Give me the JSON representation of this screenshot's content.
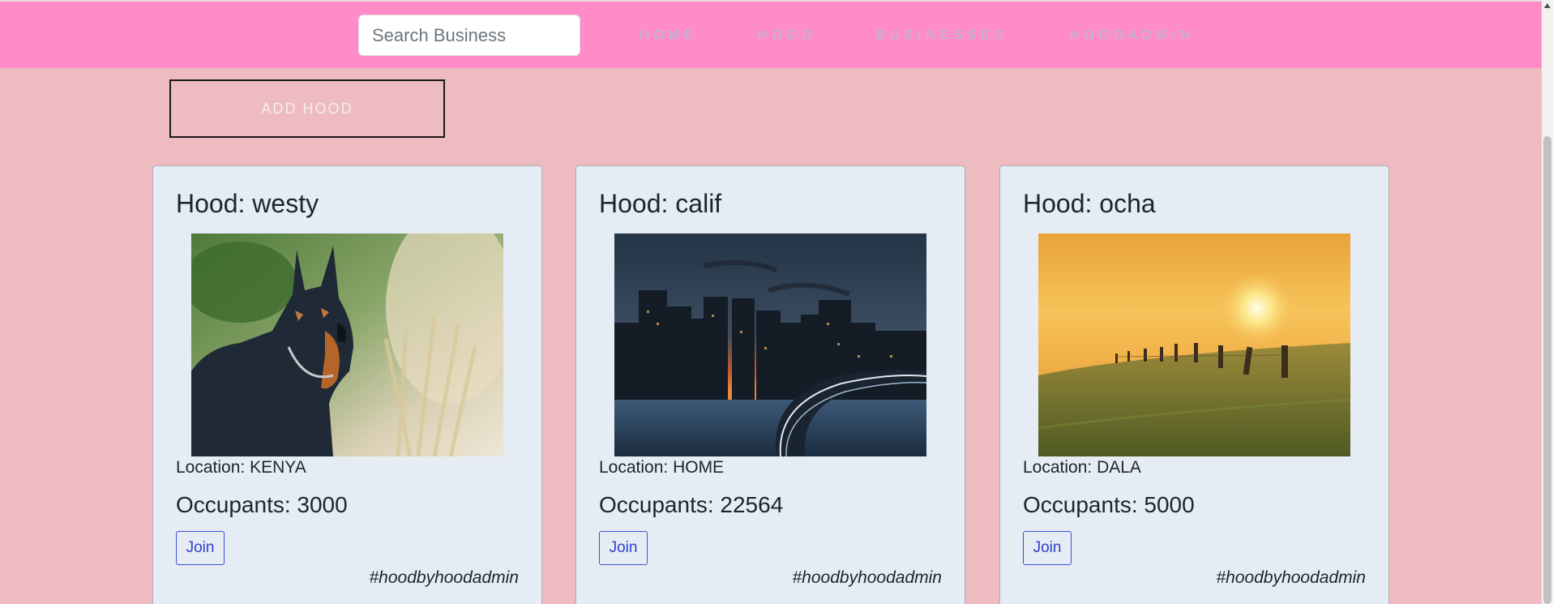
{
  "navbar": {
    "search_placeholder": "Search Business",
    "links": [
      "HOME",
      "HOOD",
      "BUSINESSES",
      "HOODADMIN"
    ]
  },
  "actions": {
    "add_hood_label": "ADD HOOD"
  },
  "hoods": [
    {
      "title": "Hood: westy",
      "location": "Location: KENYA",
      "occupants": "Occupants: 3000",
      "join_label": "Join",
      "tag": "#hoodbyhoodadmin"
    },
    {
      "title": "Hood: calif",
      "location": "Location: HOME",
      "occupants": "Occupants: 22564",
      "join_label": "Join",
      "tag": "#hoodbyhoodadmin"
    },
    {
      "title": "Hood: ocha",
      "location": "Location: DALA",
      "occupants": "Occupants: 5000",
      "join_label": "Join",
      "tag": "#hoodbyhoodadmin"
    }
  ],
  "colors": {
    "page_bg": "#eebbc0",
    "navbar_bg": "#ff8cc6",
    "nav_link": "#9ec5dc",
    "card_bg": "#e6ecf3",
    "join_accent": "#2d3fd0"
  }
}
